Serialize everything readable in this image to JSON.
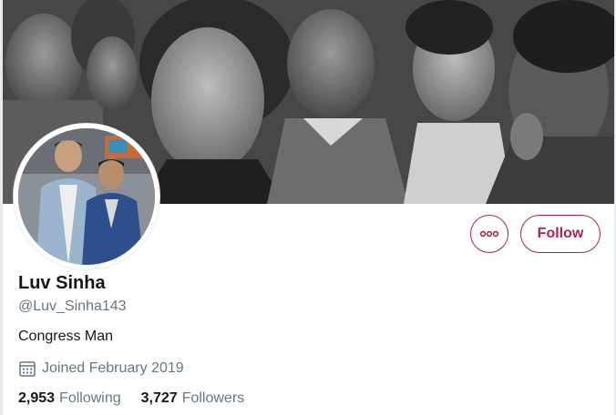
{
  "profile": {
    "name": "Luv Sinha",
    "handle": "@Luv_Sinha143",
    "bio": "Congress Man",
    "joined": "Joined February 2019"
  },
  "stats": {
    "following_count": "2,953",
    "following_label": "Following",
    "followers_count": "3,727",
    "followers_label": "Followers"
  },
  "actions": {
    "follow_label": "Follow",
    "more_icon": "more-horizontal-icon"
  },
  "icons": {
    "joined": "calendar-icon"
  },
  "colors": {
    "accent": "#a3245a",
    "text_primary": "#14171a",
    "text_secondary": "#657786"
  }
}
